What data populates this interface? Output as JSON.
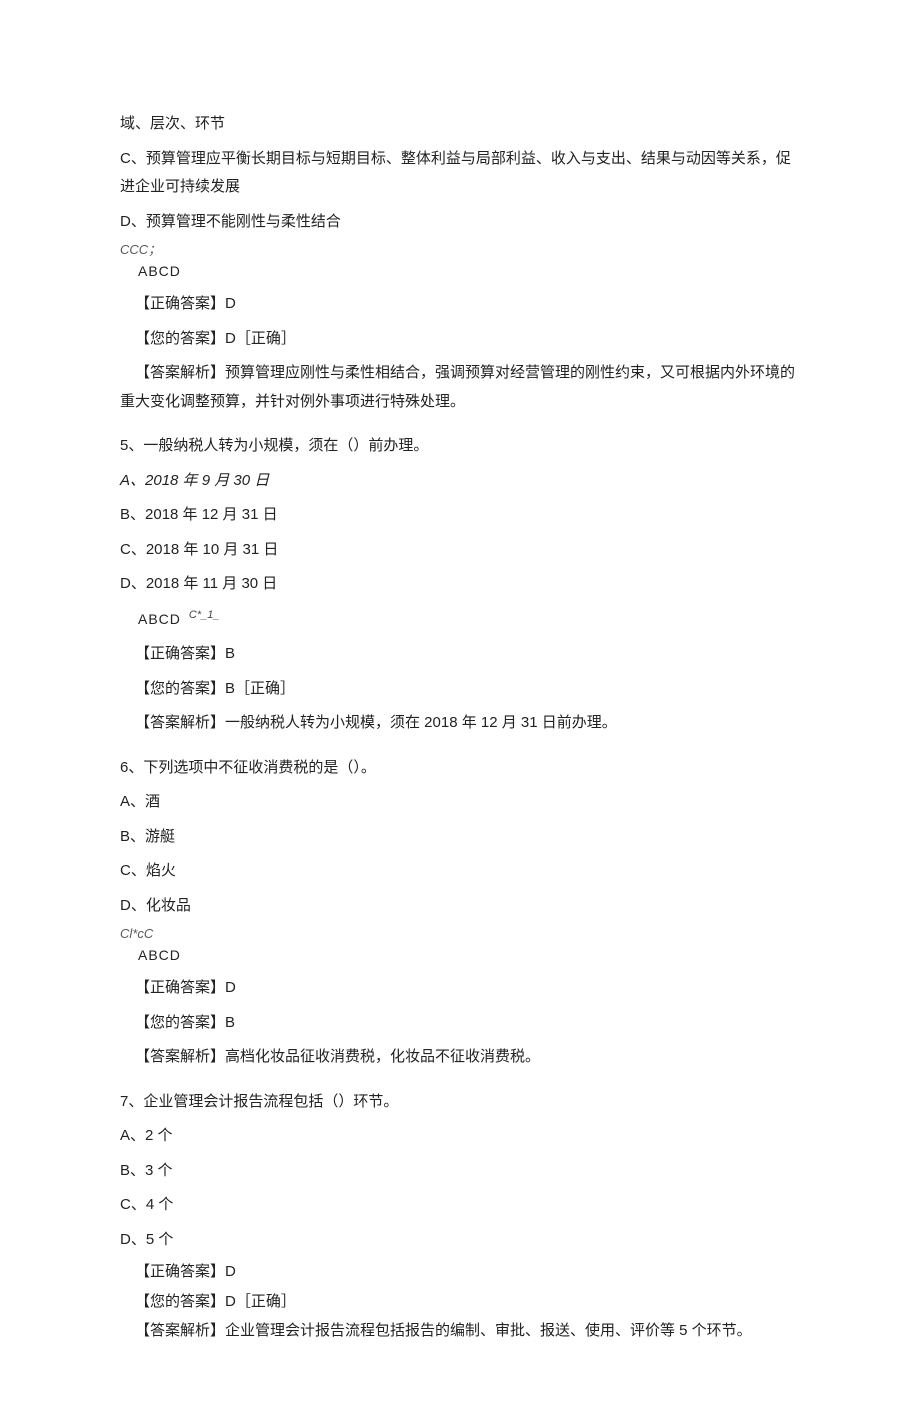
{
  "q4_tail": {
    "line1": "域、层次、环节",
    "optC": "C、预算管理应平衡长期目标与短期目标、整体利益与局部利益、收入与支出、结果与动因等关系，促进企业可持续发展",
    "optD": "D、预算管理不能刚性与柔性结合",
    "radio_note": "CCC；",
    "radio_letters": "ABCD",
    "correct": "【正确答案】D",
    "yours": "【您的答案】D［正确］",
    "explain": "【答案解析】预算管理应刚性与柔性相结合，强调预算对经营管理的刚性约束，又可根据内外环境的重大变化调整预算，并针对例外事项进行特殊处理。"
  },
  "q5": {
    "stem": "5、一般纳税人转为小规模，须在（）前办理。",
    "optA": "A、2018 年 9 月 30 日",
    "optB": "B、2018 年 12 月 31 日",
    "optC": "C、2018 年 10 月 31 日",
    "optD": "D、2018 年 11 月 30 日",
    "radio_letters": "ABCD",
    "sup_note": "C*_1_",
    "correct": "【正确答案】B",
    "yours": "【您的答案】B［正确］",
    "explain": "【答案解析】一般纳税人转为小规模，须在 2018 年 12 月 31 日前办理。"
  },
  "q6": {
    "stem": "6、下列选项中不征收消费税的是（）。",
    "optA": "A、酒",
    "optB": "B、游艇",
    "optC": "C、焰火",
    "optD": "D、化妆品",
    "radio_note": "Cl*cC",
    "radio_letters": "ABCD",
    "correct": "【正确答案】D",
    "yours": "【您的答案】B",
    "explain": "【答案解析】高档化妆品征收消费税，化妆品不征收消费税。"
  },
  "q7": {
    "stem": "7、企业管理会计报告流程包括（）环节。",
    "optA": "A、2 个",
    "optB": "B、3 个",
    "optC": "C、4 个",
    "optD": "D、5 个",
    "correct": "【正确答案】D",
    "yours": "【您的答案】D［正确］",
    "explain": "【答案解析】企业管理会计报告流程包括报告的编制、审批、报送、使用、评价等 5 个环节。"
  }
}
